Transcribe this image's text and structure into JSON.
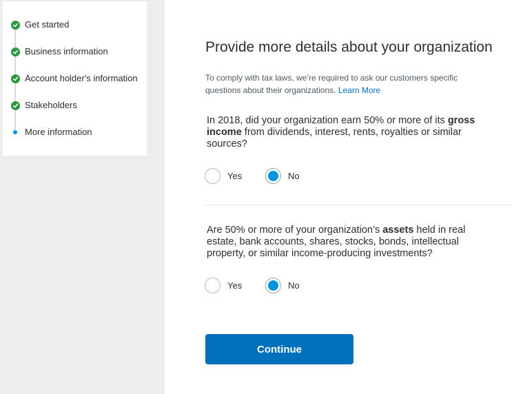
{
  "stepper": {
    "steps": [
      {
        "label": "Get started",
        "status": "complete"
      },
      {
        "label": "Business information",
        "status": "complete"
      },
      {
        "label": "Account holder's information",
        "status": "complete"
      },
      {
        "label": "Stakeholders",
        "status": "complete"
      },
      {
        "label": "More information",
        "status": "current"
      }
    ]
  },
  "page": {
    "title": "Provide more details about your organization",
    "intro_text": "To comply with tax laws, we’re required to ask our customers specific questions about their organizations.",
    "learn_more": "Learn More"
  },
  "question1": {
    "text_before": "In 2018, did your organization earn 50% or more of its ",
    "bold": "gross income",
    "text_after": " from dividends, interest, rents, royalties or similar sources?",
    "options": [
      "Yes",
      "No"
    ],
    "selected": "No"
  },
  "question2": {
    "text_before": "Are 50% or more of your organization’s ",
    "bold": "assets",
    "text_after": " held in real estate, bank accounts, shares, stocks, bonds, intellectual property, or similar income-producing investments?",
    "options": [
      "Yes",
      "No"
    ],
    "selected": "No"
  },
  "actions": {
    "continue_label": "Continue"
  },
  "colors": {
    "complete": "#2c9942",
    "current": "#0094dc",
    "primary": "#0070ba"
  },
  "icons": {
    "complete_step": "check-circle-icon",
    "current_step": "dot-icon"
  }
}
